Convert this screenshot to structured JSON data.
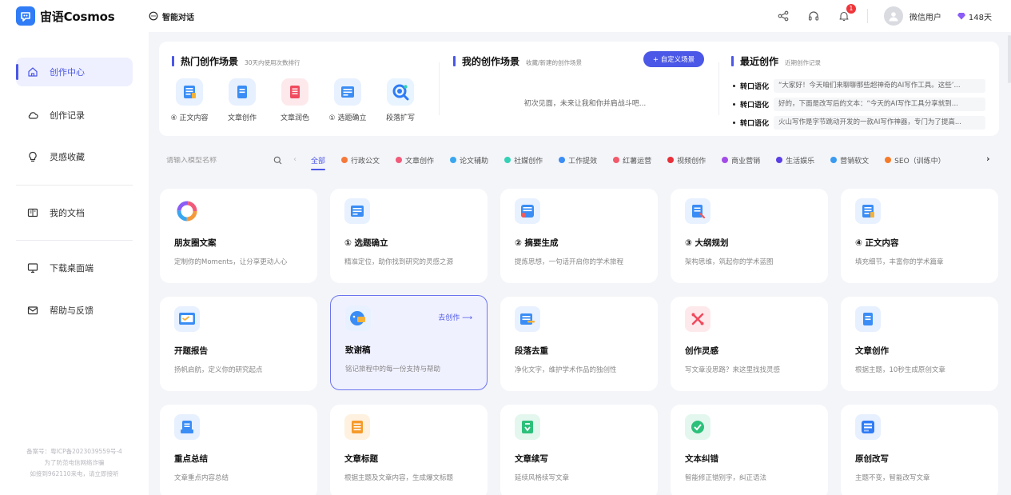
{
  "app": {
    "name": "宙语Cosmos",
    "accent": "#4b57e6",
    "logo_color": "#2f7cf6"
  },
  "topbar": {
    "chat_tab": "智能对话",
    "notification_count": "1",
    "username": "微信用户",
    "vip_days": "148天"
  },
  "sidebar": {
    "items": [
      {
        "label": "创作中心",
        "icon": "home-icon",
        "active": true
      },
      {
        "label": "创作记录",
        "icon": "cloud-icon"
      },
      {
        "label": "灵感收藏",
        "icon": "bulb-icon"
      },
      {
        "label": "我的文档",
        "icon": "book-icon"
      },
      {
        "label": "下载桌面端",
        "icon": "monitor-icon"
      },
      {
        "label": "帮助与反馈",
        "icon": "mail-icon"
      }
    ],
    "icp_line1": "备案号：粤ICP备2023039559号-4",
    "icp_line2": "为了防范电信网络诈骗",
    "icp_line3": "如接到962110来电，请立即接听"
  },
  "hot": {
    "title": "热门创作场景",
    "subtitle": "30天内使用次数排行",
    "items": [
      {
        "label": "④ 正文内容",
        "bg": "#e8f1ff",
        "color": "#3a8df5"
      },
      {
        "label": "文章创作",
        "bg": "#e7f0fe",
        "color": "#3a8df5"
      },
      {
        "label": "文章润色",
        "bg": "#fde9ec",
        "color": "#f04a5e"
      },
      {
        "label": "① 选题确立",
        "bg": "#e8f1ff",
        "color": "#3a8df5"
      },
      {
        "label": "段落扩写",
        "bg": "#e8f4ff",
        "color": "#2f7cf6"
      }
    ]
  },
  "mine": {
    "title": "我的创作场景",
    "subtitle": "收藏/新建的创作场景",
    "button": "+ 自定义场景",
    "empty": "初次见面，未来让我和你并肩战斗吧..."
  },
  "recent": {
    "title": "最近创作",
    "subtitle": "近期创作记录",
    "items": [
      {
        "tag": "转口语化",
        "text": "“大家好！今天咱们来聊聊那些超神奇的AI写作工具。这些’..."
      },
      {
        "tag": "转口语化",
        "text": "好的，下面是改写后的文本：“今天的AI写作工具分享就到..."
      },
      {
        "tag": "转口语化",
        "text": "火山写作是字节跳动开发的一款AI写作神器，专门为了提高..."
      }
    ]
  },
  "search": {
    "placeholder": "请输入模型名称"
  },
  "categories": [
    {
      "label": "全部",
      "active": true
    },
    {
      "label": "行政公文",
      "color": "#f5793b"
    },
    {
      "label": "文章创作",
      "color": "#f25a7a"
    },
    {
      "label": "论文辅助",
      "color": "#3aa6f0"
    },
    {
      "label": "社媒创作",
      "color": "#34d1b6"
    },
    {
      "label": "工作提效",
      "color": "#3a8df5"
    },
    {
      "label": "红薯运营",
      "color": "#f25a6c"
    },
    {
      "label": "视频创作",
      "color": "#e8303a"
    },
    {
      "label": "商业营销",
      "color": "#a24ce6"
    },
    {
      "label": "生活娱乐",
      "color": "#5a3ee6"
    },
    {
      "label": "营销软文",
      "color": "#3a9bf0"
    },
    {
      "label": "SEO（训练中）",
      "color": "#f57b28"
    }
  ],
  "cards": [
    {
      "title": "朋友圈文案",
      "desc": "定制你的Moments，让分享更动人心",
      "icon": "ring-icon",
      "bg": "#ffffff",
      "color": "#f59a3a"
    },
    {
      "title": "① 选题确立",
      "desc": "精准定位，助你找到研究的灵感之源",
      "icon": "document-icon",
      "bg": "#e8f1ff",
      "color": "#3a8df5"
    },
    {
      "title": "② 摘要生成",
      "desc": "提炼思想，一句话开启你的学术旅程",
      "icon": "document-icon",
      "bg": "#e8f1ff",
      "color": "#3a8df5"
    },
    {
      "title": "③ 大纲规划",
      "desc": "架构思维，筑起你的学术蓝图",
      "icon": "document-icon",
      "bg": "#e8f1ff",
      "color": "#3a8df5"
    },
    {
      "title": "④ 正文内容",
      "desc": "填充细节，丰富你的学术篇章",
      "icon": "document-icon",
      "bg": "#e8f1ff",
      "color": "#3a8df5"
    },
    {
      "title": "开题报告",
      "desc": "扬帆启航，定义你的研究起点",
      "icon": "report-icon",
      "bg": "#e8f1ff",
      "color": "#3a8df5"
    },
    {
      "title": "致谢稿",
      "desc": "铭记旅程中的每一份支持与帮助",
      "icon": "thanks-icon",
      "bg": "#e8f1ff",
      "color": "#3a8df5",
      "action": "去创作 ⟶"
    },
    {
      "title": "段落去重",
      "desc": "净化文字，维护学术作品的独创性",
      "icon": "document-icon",
      "bg": "#e8f1ff",
      "color": "#3a8df5"
    },
    {
      "title": "创作灵感",
      "desc": "写文章没思路？来这里找找灵感",
      "icon": "inspiration-icon",
      "bg": "#fde9ec",
      "color": "#f04a5e"
    },
    {
      "title": "文章创作",
      "desc": "根据主题，10秒生成原创文章",
      "icon": "article-icon",
      "bg": "#e7f0fe",
      "color": "#3a8df5"
    },
    {
      "title": "重点总结",
      "desc": "文章重点内容总结",
      "icon": "summary-icon",
      "bg": "#e7f0fe",
      "color": "#3a8df5"
    },
    {
      "title": "文章标题",
      "desc": "根据主题及文章内容，生成爆文标题",
      "icon": "title-icon",
      "bg": "#fef1df",
      "color": "#f59a2a"
    },
    {
      "title": "文章续写",
      "desc": "延续风格续写文章",
      "icon": "continue-icon",
      "bg": "#e3f7ee",
      "color": "#2cc07a"
    },
    {
      "title": "文本纠错",
      "desc": "智能修正错别字，纠正语法",
      "icon": "check-icon",
      "bg": "#e3f7ee",
      "color": "#2cc07a"
    },
    {
      "title": "原创改写",
      "desc": "主题不变，智能改写文章",
      "icon": "rewrite-icon",
      "bg": "#e7f0fe",
      "color": "#2f7cf6"
    }
  ]
}
